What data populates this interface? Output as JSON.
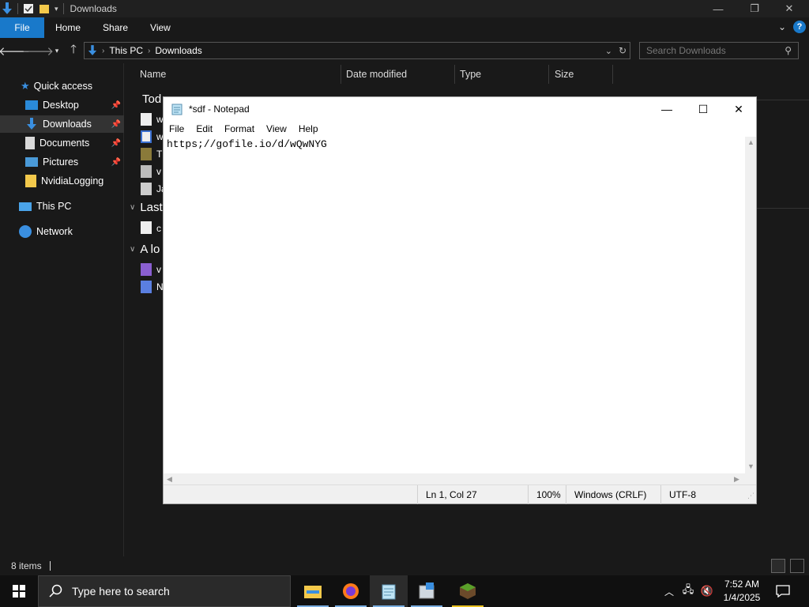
{
  "explorer": {
    "title": "Downloads",
    "ribbon_tabs": [
      "File",
      "Home",
      "Share",
      "View"
    ],
    "breadcrumb": [
      "This PC",
      "Downloads"
    ],
    "search_placeholder": "Search Downloads",
    "nav": {
      "quick_access": "Quick access",
      "desktop": "Desktop",
      "downloads": "Downloads",
      "documents": "Documents",
      "pictures": "Pictures",
      "nvidialogging": "NvidiaLogging",
      "this_pc": "This PC",
      "network": "Network"
    },
    "columns": [
      "Name",
      "Date modified",
      "Type",
      "Size"
    ],
    "groups": {
      "today": "Tod",
      "last": "Last",
      "long_ago": "A lo"
    },
    "files": {
      "today": [
        "w",
        "w",
        "T",
        "v",
        "Ja"
      ],
      "last": [
        "c"
      ],
      "long_ago": [
        "v",
        "N"
      ]
    },
    "status_count": "8 items"
  },
  "notepad": {
    "title": "*sdf - Notepad",
    "menu": [
      "File",
      "Edit",
      "Format",
      "View",
      "Help"
    ],
    "content": "https;//gofile.io/d/wQwNYG",
    "status": {
      "position": "Ln 1, Col 27",
      "zoom": "100%",
      "line_ending": "Windows (CRLF)",
      "encoding": "UTF-8"
    }
  },
  "taskbar": {
    "search_placeholder": "Type here to search",
    "time": "7:52 AM",
    "date": "1/4/2025"
  },
  "colors": {
    "accent": "#1979ca",
    "explorer_bg": "#191919",
    "taskbar_bg": "#101010"
  }
}
